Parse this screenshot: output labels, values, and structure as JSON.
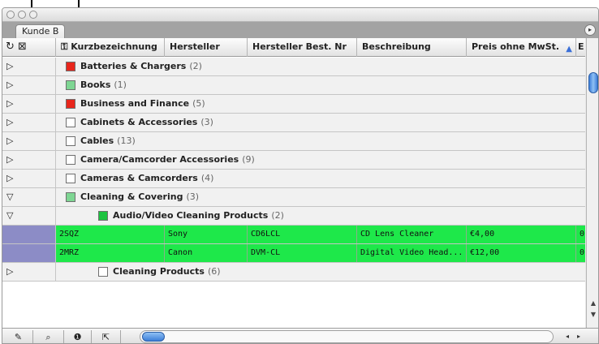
{
  "window": {
    "tab_label": "Kunde B"
  },
  "icons": {
    "tab_scroll": "▸",
    "refresh": "↻",
    "checkbox": "⊠",
    "key": "⚿",
    "sort": "▲",
    "collapsed": "▷",
    "expanded": "▽",
    "scroll_up": "▲",
    "scroll_down": "▼",
    "scroll_left": "◂",
    "scroll_right": "▸",
    "pencil": "✎",
    "binoculars": "⌕",
    "info": "❶",
    "arrows": "⇱"
  },
  "columns": [
    {
      "label": "Kurzbezeichnung"
    },
    {
      "label": "Hersteller"
    },
    {
      "label": "Hersteller Best. Nr"
    },
    {
      "label": "Beschreibung"
    },
    {
      "label": "Preis ohne MwSt."
    },
    {
      "label": "E"
    }
  ],
  "groups": [
    {
      "name": "Batteries & Chargers",
      "count": "(2)",
      "color": "#e8261c"
    },
    {
      "name": "Books",
      "count": "(1)",
      "color": "#7ed693"
    },
    {
      "name": "Business and Finance",
      "count": "(5)",
      "color": "#e8261c"
    },
    {
      "name": "Cabinets & Accessories",
      "count": "(3)",
      "color": "#ffffff"
    },
    {
      "name": "Cables",
      "count": "(13)",
      "color": "#ffffff"
    },
    {
      "name": "Camera/Camcorder Accessories",
      "count": "(9)",
      "color": "#ffffff"
    },
    {
      "name": "Cameras & Camcorders",
      "count": "(4)",
      "color": "#ffffff"
    },
    {
      "name": "Cleaning & Covering",
      "count": "(3)",
      "color": "#7ed693"
    },
    {
      "name": "Audio/Video Cleaning Products",
      "count": "(2)",
      "color": "#1cc33f"
    },
    {
      "name": "Cleaning Products",
      "count": "(6)",
      "color": "#ffffff"
    }
  ],
  "items": [
    {
      "kurz": "2SQZ",
      "hersteller": "Sony",
      "best_nr": "CD6LCL",
      "beschreibung": "CD Lens Cleaner",
      "preis": "€4,00",
      "extra": "0"
    },
    {
      "kurz": "2MRZ",
      "hersteller": "Canon",
      "best_nr": "DVM-CL",
      "beschreibung": "Digital Video Head...",
      "preis": "€12,00",
      "extra": "0"
    }
  ],
  "colors": {
    "item_row": "#1ee84a",
    "selected_expander": "#8c8cc6",
    "accent_blue": "#3c7ed8"
  }
}
